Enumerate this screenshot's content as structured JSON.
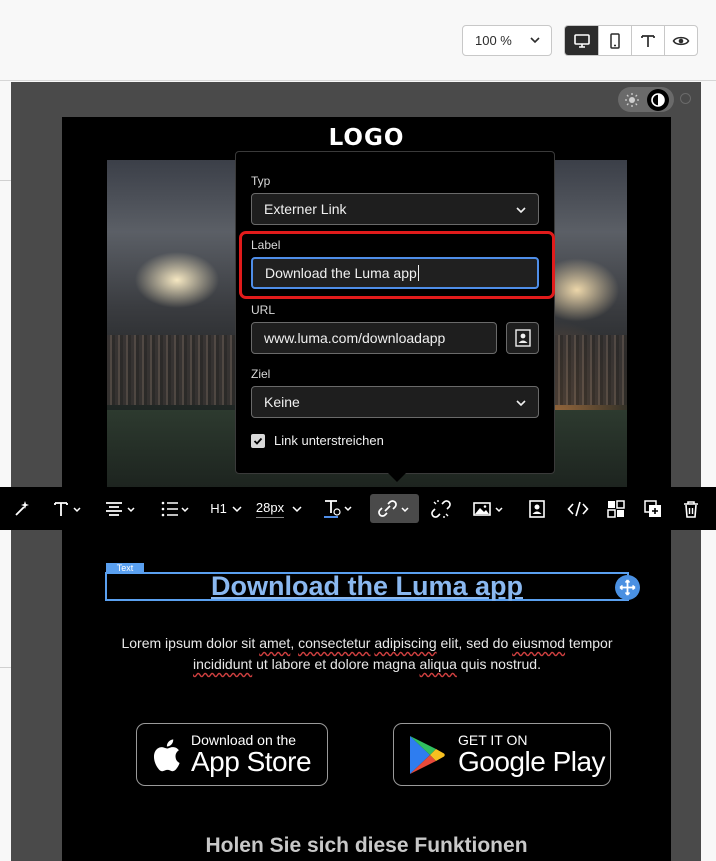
{
  "topbar": {
    "zoom_value": "100 %",
    "view_buttons": [
      "desktop-view",
      "mobile-view",
      "text-view",
      "preview"
    ]
  },
  "email": {
    "logo": "LOGO",
    "text_tag": "Text",
    "headline": "Download the Luma app",
    "lorem_parts": [
      "Lorem ipsum dolor sit ",
      "amet",
      ", ",
      "consectetur",
      " ",
      "adipiscing",
      " elit, sed do ",
      "eiusmod",
      " tempor ",
      "incididunt",
      " ut labore et dolore magna ",
      "aliqua",
      " quis nostrud."
    ],
    "apple_small": "Download on the",
    "apple_big": "App Store",
    "google_small": "GET IT ON",
    "google_big": "Google Play",
    "section_heading": "Holen Sie sich diese Funktionen"
  },
  "toolbar": {
    "heading_level": "H1",
    "font_size": "28px"
  },
  "link_popover": {
    "type_label": "Typ",
    "type_value": "Externer Link",
    "label_label": "Label",
    "label_value": "Download the Luma app",
    "url_label": "URL",
    "url_value": "www.luma.com/downloadapp",
    "target_label": "Ziel",
    "target_value": "Keine",
    "underline_label": "Link unterstreichen",
    "underline_checked": true
  },
  "colors": {
    "highlight_red": "#e11b1b",
    "focus_blue": "#4f8ee8",
    "selection_blue": "#5aa0f0"
  }
}
